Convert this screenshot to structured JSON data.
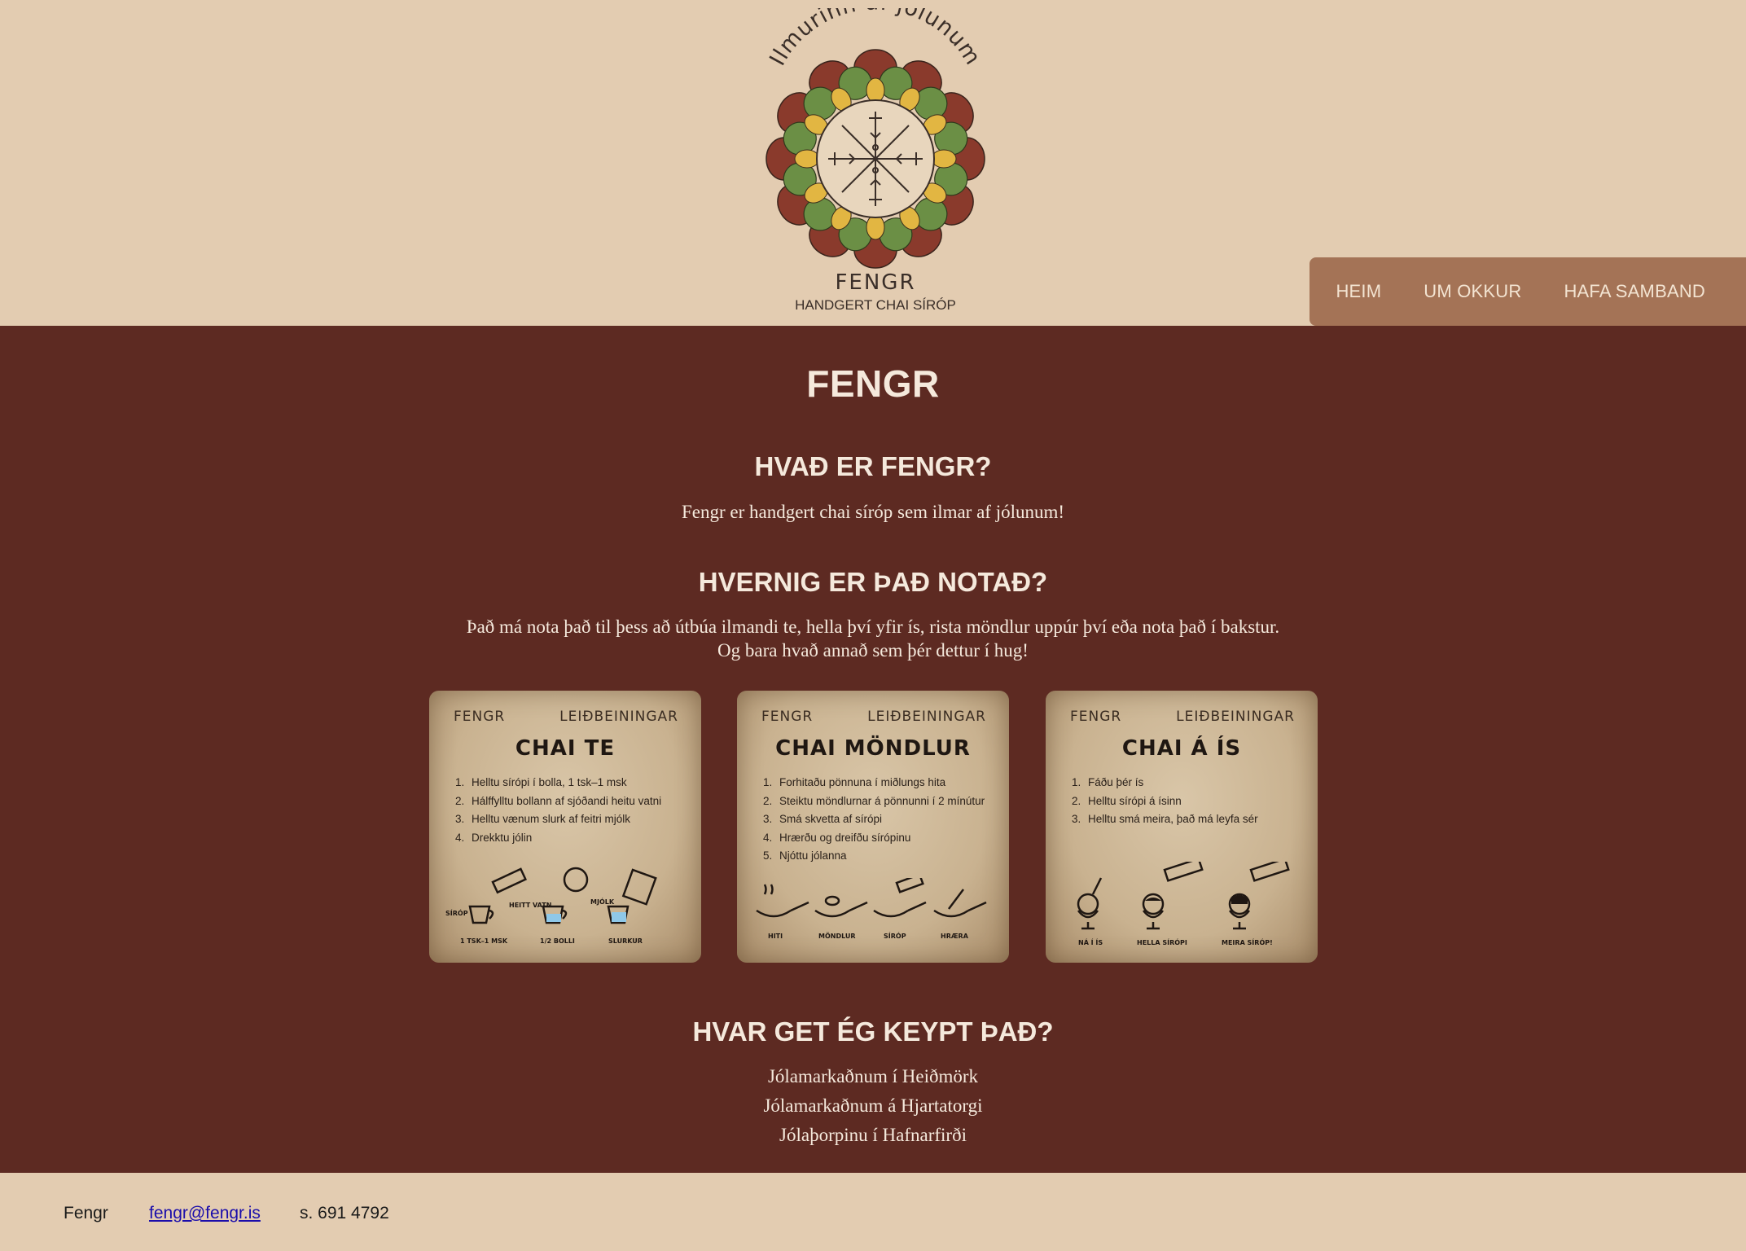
{
  "header": {
    "logo_arc_text": "Ilmurinn af jólunum",
    "logo_brand": "FENGR",
    "logo_tagline": "HANDGERT CHAI SÍRÓP",
    "nav": [
      {
        "label": "HEIM"
      },
      {
        "label": "UM OKKUR"
      },
      {
        "label": "HAFA SAMBAND"
      }
    ]
  },
  "main": {
    "title": "FENGR",
    "what_heading": "HVAÐ ER FENGR?",
    "what_text": "Fengr er handgert chai síróp sem ilmar af jólunum!",
    "how_heading": "HVERNIG ER ÞAÐ NOTAÐ?",
    "how_text_1": "Það má nota það til þess að útbúa ilmandi te, hella því yfir ís, rista möndlur uppúr því eða nota það í bakstur.",
    "how_text_2": "Og bara hvað annað sem þér dettur í hug!",
    "cards": [
      {
        "brand": "FENGR",
        "tag": "LEIÐBEININGAR",
        "title": "CHAI TE",
        "steps": [
          "Helltu sírópi í bolla, 1 tsk–1 msk",
          "Hálffylltu bollann af sjóðandi heitu vatni",
          "Helltu vænum slurk af feitri mjólk",
          "Drekktu jólin"
        ],
        "labels": [
          "SÍRÓP",
          "HEITT VATN",
          "MJÓLK",
          "1 TSK–1 MSK",
          "1/2 BOLLI",
          "SLURKUR"
        ]
      },
      {
        "brand": "FENGR",
        "tag": "LEIÐBEININGAR",
        "title": "CHAI MÖNDLUR",
        "steps": [
          "Forhitaðu pönnuna í miðlungs hita",
          "Steiktu möndlurnar á pönnunni í 2 mínútur",
          "Smá skvetta af sírópi",
          "Hrærðu og dreifðu sírópinu",
          "Njóttu jólanna"
        ],
        "labels": [
          "HITI",
          "MÖNDLUR",
          "SÍRÓP",
          "HRÆRA"
        ]
      },
      {
        "brand": "FENGR",
        "tag": "LEIÐBEININGAR",
        "title": "CHAI Á ÍS",
        "steps": [
          "Fáðu þér ís",
          "Helltu sírópi á ísinn",
          "Helltu smá meira, það má leyfa sér"
        ],
        "labels": [
          "NÁ Í ÍS",
          "HELLA SÍRÓPI",
          "MEIRA SÍRÓP!"
        ]
      }
    ],
    "where_heading": "HVAR GET ÉG KEYPT ÞAÐ?",
    "where_items": [
      "Jólamarkaðnum í Heiðmörk",
      "Jólamarkaðnum á Hjartatorgi",
      "Jólaþorpinu í Hafnarfirði"
    ]
  },
  "footer": {
    "name": "Fengr",
    "email": "fengr@fengr.is",
    "phone": "s. 691 4792"
  },
  "colors": {
    "header_bg": "#e3ccb1",
    "main_bg": "#5d2a22",
    "nav_bg": "#a47356",
    "text_light": "#f5e9dc"
  }
}
